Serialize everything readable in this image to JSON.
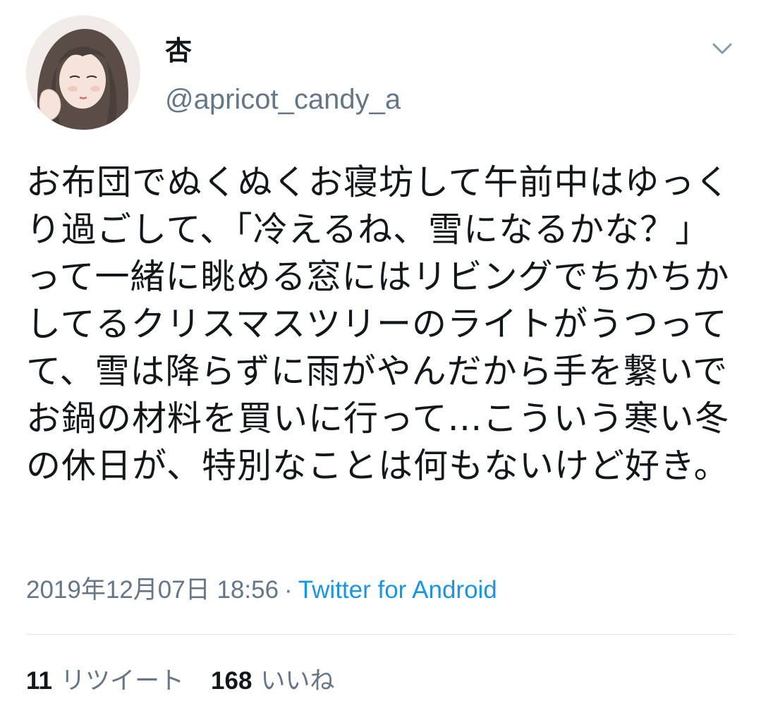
{
  "user": {
    "display_name": "杏",
    "handle": "@apricot_candy_a",
    "avatar_icon": "avatar-illustration"
  },
  "menu": {
    "icon": "chevron-down-icon"
  },
  "tweet": {
    "text": "お布団でぬくぬくお寝坊して午前中はゆっくり過ごして、「冷えるね、雪になるかな？」って一緒に眺める窓にはリビングでちかちかしてるクリスマスツリーのライトがうつってて、雪は降らずに雨がやんだから手を繋いでお鍋の材料を買いに行って…こういう寒い冬の休日が、特別なことは何もないけど好き。",
    "date": "2019年12月07日 18:56",
    "separator": "·",
    "source": "Twitter for Android"
  },
  "stats": {
    "retweets_count": "11",
    "retweets_label": "リツイート",
    "likes_count": "168",
    "likes_label": "いいね"
  },
  "colors": {
    "text": "#14171a",
    "secondary": "#657786",
    "link": "#1b95e0",
    "divider": "#e1e8ed"
  }
}
